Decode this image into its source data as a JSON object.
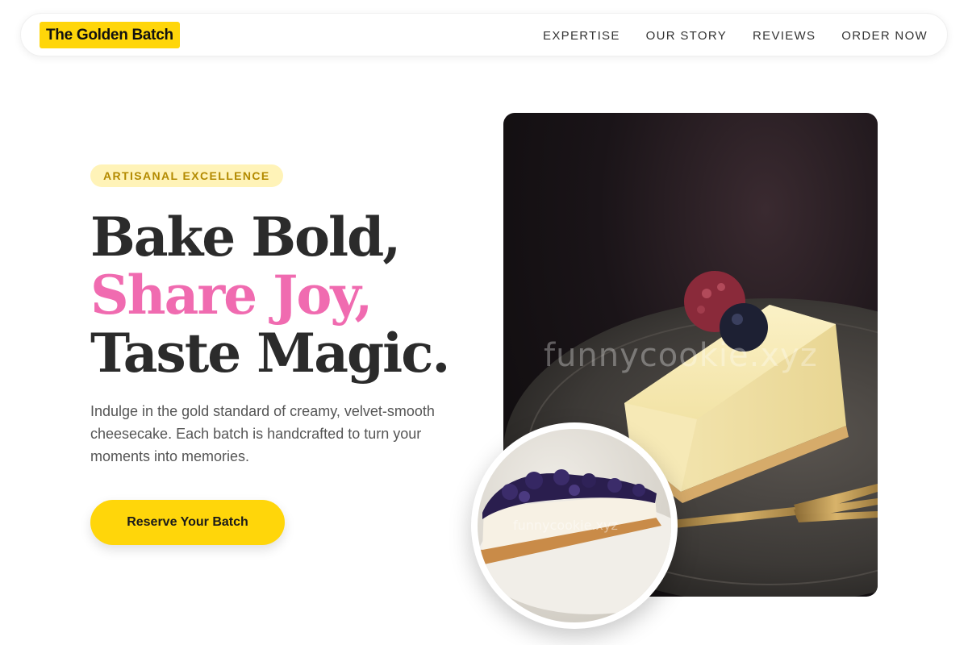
{
  "nav": {
    "logo": "The Golden Batch",
    "links": [
      "EXPERTISE",
      "OUR STORY",
      "REVIEWS",
      "ORDER NOW"
    ]
  },
  "hero": {
    "badge": "ARTISANAL EXCELLENCE",
    "headline": [
      "Bake Bold,",
      "Share Joy,",
      "Taste Magic."
    ],
    "lead": "Indulge in the gold standard of creamy, velvet-smooth cheesecake. Each batch is handcrafted to turn your moments into memories.",
    "cta": "Reserve Your Batch"
  },
  "images": {
    "main_watermark": "funnycookie.xyz",
    "secondary_watermark": "funnycookie.xyz"
  },
  "colors": {
    "accent_yellow": "#ffd60a",
    "accent_pink": "#f06bb0",
    "text_dark": "#2b2b2b"
  }
}
